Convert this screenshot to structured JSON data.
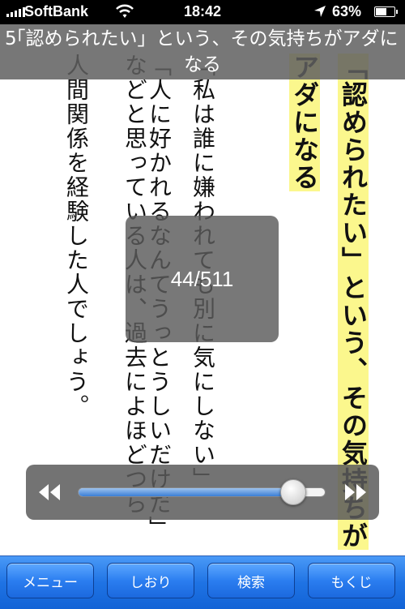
{
  "status_bar": {
    "carrier": "SoftBank",
    "time": "18:42",
    "battery_percent": "63%",
    "battery_level": 0.63,
    "icons": [
      "signal-bars-icon",
      "wifi-icon",
      "location-arrow-icon",
      "battery-icon"
    ]
  },
  "chapter": {
    "number": "5",
    "title": "「認められたい」という、その気持ちがアダになる"
  },
  "page_text": {
    "heading_col1": "「認められたい」という、その気持ちが",
    "heading_col2": "アダになる",
    "body_col1": "「私は誰に嫌われても別に気にしない」",
    "body_col2": "「人に好かれるなんてうっとうしいだけだ」",
    "body_col3": "などと思っている人は、過去によほどつら",
    "body_col4": "人間関係を経験した人でしょう。"
  },
  "page_indicator": {
    "text": "44/511"
  },
  "slider": {
    "position_fraction": 0.87,
    "rewind_icon": "rewind-icon",
    "forward_icon": "fast-forward-icon"
  },
  "toolbar": {
    "menu_label": "メニュー",
    "bookmark_label": "しおり",
    "search_label": "検索",
    "toc_label": "もくじ"
  },
  "colors": {
    "highlight": "#fbf78d",
    "toolbar_blue": "#1f73e4",
    "overlay_gray": "#5a5a5a"
  }
}
